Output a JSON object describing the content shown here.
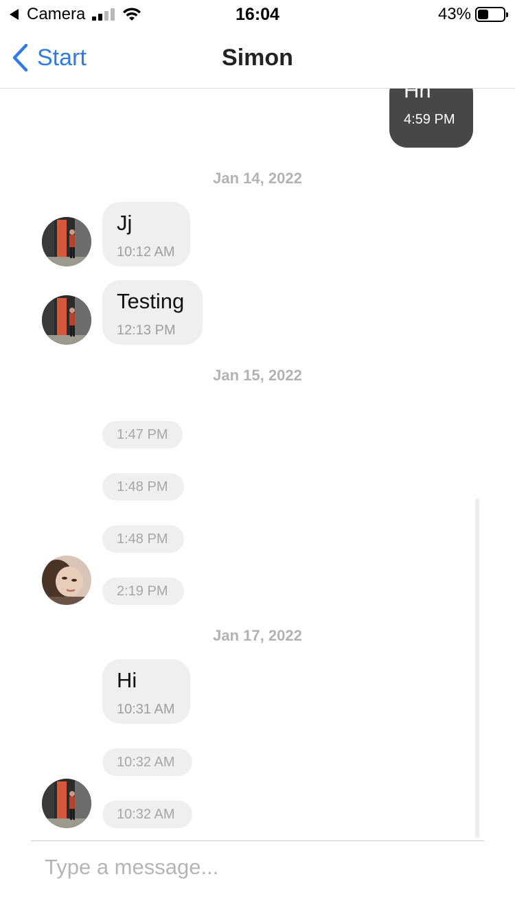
{
  "status_bar": {
    "carrier": "Camera",
    "time": "16:04",
    "battery_percent": "43%",
    "battery_level": 0.43,
    "signal_bars_active": 2,
    "signal_bars_total": 4
  },
  "nav": {
    "back_label": "Start",
    "title": "Simon",
    "accent_color": "#2f7ae5"
  },
  "dates": {
    "d1": "Jan 14, 2022",
    "d2": "Jan 15, 2022",
    "d3": "Jan 17, 2022"
  },
  "messages": [
    {
      "text": "Hh",
      "time": "4:59 PM",
      "sent": true
    },
    {
      "text": "Jj",
      "time": "10:12 AM"
    },
    {
      "text": "Testing",
      "time": "12:13 PM"
    },
    {
      "text": "",
      "time": "1:47 PM"
    },
    {
      "text": "",
      "time": "1:48 PM"
    },
    {
      "text": "",
      "time": "1:48 PM"
    },
    {
      "text": "",
      "time": "2:19 PM"
    },
    {
      "text": "Hi",
      "time": "10:31 AM"
    },
    {
      "text": "",
      "time": "10:32 AM"
    },
    {
      "text": "",
      "time": "10:32 AM"
    }
  ],
  "composer": {
    "placeholder": "Type a message..."
  },
  "colors": {
    "sent_bubble": "#474747",
    "received_bubble": "#efefef"
  }
}
